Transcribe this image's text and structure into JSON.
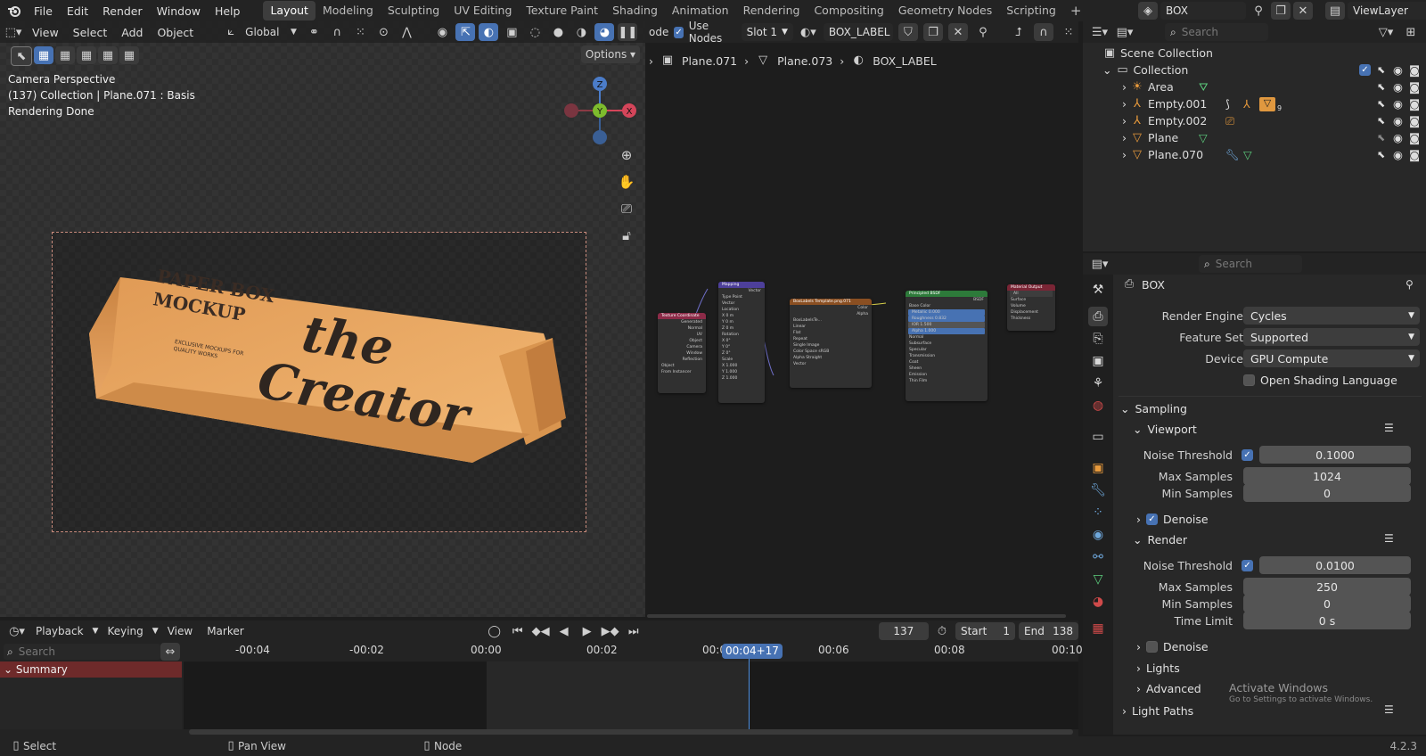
{
  "topbar": {
    "menus": [
      "File",
      "Edit",
      "Render",
      "Window",
      "Help"
    ],
    "workspaces": [
      "Layout",
      "Modeling",
      "Sculpting",
      "UV Editing",
      "Texture Paint",
      "Shading",
      "Animation",
      "Rendering",
      "Compositing",
      "Geometry Nodes",
      "Scripting"
    ],
    "active_workspace": "Layout",
    "scene_name": "BOX",
    "view_layer": "ViewLayer"
  },
  "viewport": {
    "menus": [
      "View",
      "Select",
      "Add",
      "Object"
    ],
    "orientation": "Global",
    "options_label": "Options",
    "info_lines": [
      "Camera Perspective",
      "(137) Collection | Plane.071 : Basis",
      "Rendering Done"
    ],
    "gizmo_axes": {
      "z": "Z",
      "y": "Y",
      "x": "X"
    },
    "mockup": {
      "title_line1": "PAPER BOX",
      "title_line2": "MOCKUP",
      "script_line1": "the",
      "script_line2": "Creator",
      "tagline1": "EXCLUSIVE MOCKUPS FOR",
      "tagline2": "QUALITY WORKS"
    }
  },
  "node_editor": {
    "header_partial": "ode",
    "use_nodes_label": "Use Nodes",
    "slot": "Slot 1",
    "material": "BOX_LABEL",
    "breadcrumb": [
      "Plane.071",
      "Plane.073",
      "BOX_LABEL"
    ],
    "nodes": {
      "texcoord": {
        "title": "Texture Coordinate",
        "rows": [
          "Generated",
          "Normal",
          "UV",
          "Object",
          "Camera",
          "Window",
          "Reflection",
          "Object",
          "From Instancer"
        ]
      },
      "mapping": {
        "title": "Mapping",
        "rows": [
          "Vector",
          "Type  Point",
          "Vector",
          "Location",
          "X 0 m",
          "Y 0 m",
          "Z 0 m",
          "Rotation",
          "X 0°",
          "Y 0°",
          "Z 0°",
          "Scale",
          "X 1.000",
          "Y 1.000",
          "Z 1.000"
        ]
      },
      "image": {
        "title": "BoxLabels Template.png.071",
        "rows": [
          "Color",
          "Alpha",
          "BoxLabelsTe...",
          "Linear",
          "Flat",
          "Repeat",
          "Single Image",
          "Color Space  sRGB",
          "Alpha  Straight",
          "Vector"
        ]
      },
      "bsdf": {
        "title": "Principled BSDF",
        "rows": [
          "BSDF",
          "Base Color",
          "Metallic 0.000",
          "Roughness 0.832",
          "IOR 1.500",
          "Alpha 1.000",
          "Normal",
          "Subsurface",
          "Specular",
          "Transmission",
          "Coat",
          "Sheen",
          "Emission",
          "Thin Film"
        ]
      },
      "output": {
        "title": "Material Output",
        "rows": [
          "All",
          "Surface",
          "Volume",
          "Displacement",
          "Thickness"
        ]
      }
    }
  },
  "outliner": {
    "search_placeholder": "Search",
    "root": "Scene Collection",
    "collection": "Collection",
    "items": [
      "Area",
      "Empty.001",
      "Empty.002",
      "Plane",
      "Plane.070"
    ],
    "badge_count": "9"
  },
  "properties": {
    "search_placeholder": "Search",
    "scene_name": "BOX",
    "render_engine_label": "Render Engine",
    "render_engine": "Cycles",
    "feature_set_label": "Feature Set",
    "feature_set": "Supported",
    "device_label": "Device",
    "device": "GPU Compute",
    "osl_label": "Open Shading Language",
    "sampling": "Sampling",
    "viewport": "Viewport",
    "vp_noise_label": "Noise Threshold",
    "vp_noise": "0.1000",
    "vp_max_label": "Max Samples",
    "vp_max": "1024",
    "vp_min_label": "Min Samples",
    "vp_min": "0",
    "denoise": "Denoise",
    "render": "Render",
    "r_noise_label": "Noise Threshold",
    "r_noise": "0.0100",
    "r_max_label": "Max Samples",
    "r_max": "250",
    "r_min_label": "Min Samples",
    "r_min": "0",
    "time_limit_label": "Time Limit",
    "time_limit": "0 s",
    "denoise2": "Denoise",
    "lights": "Lights",
    "advanced": "Advanced",
    "light_paths": "Light Paths",
    "activate_title": "Activate Windows",
    "activate_sub": "Go to Settings to activate Windows."
  },
  "timeline": {
    "menus": [
      "Playback",
      "Keying",
      "View",
      "Marker"
    ],
    "current_frame": "137",
    "start_label": "Start",
    "start": "1",
    "end_label": "End",
    "end": "138",
    "search_placeholder": "Search",
    "summary": "Summary",
    "ruler": [
      "-00:04",
      "-00:02",
      "00:00",
      "00:02",
      "00:0",
      "00:06",
      "00:08",
      "00:10"
    ],
    "playhead": "00:04+17"
  },
  "statusbar": {
    "left": "Select",
    "middle": "Pan View",
    "right": "Node",
    "version": "4.2.3"
  },
  "colors": {
    "accent": "#4772b3",
    "header": "#232323",
    "panel": "#282828",
    "box": "#e7a861",
    "summary": "#6e2a2a"
  }
}
